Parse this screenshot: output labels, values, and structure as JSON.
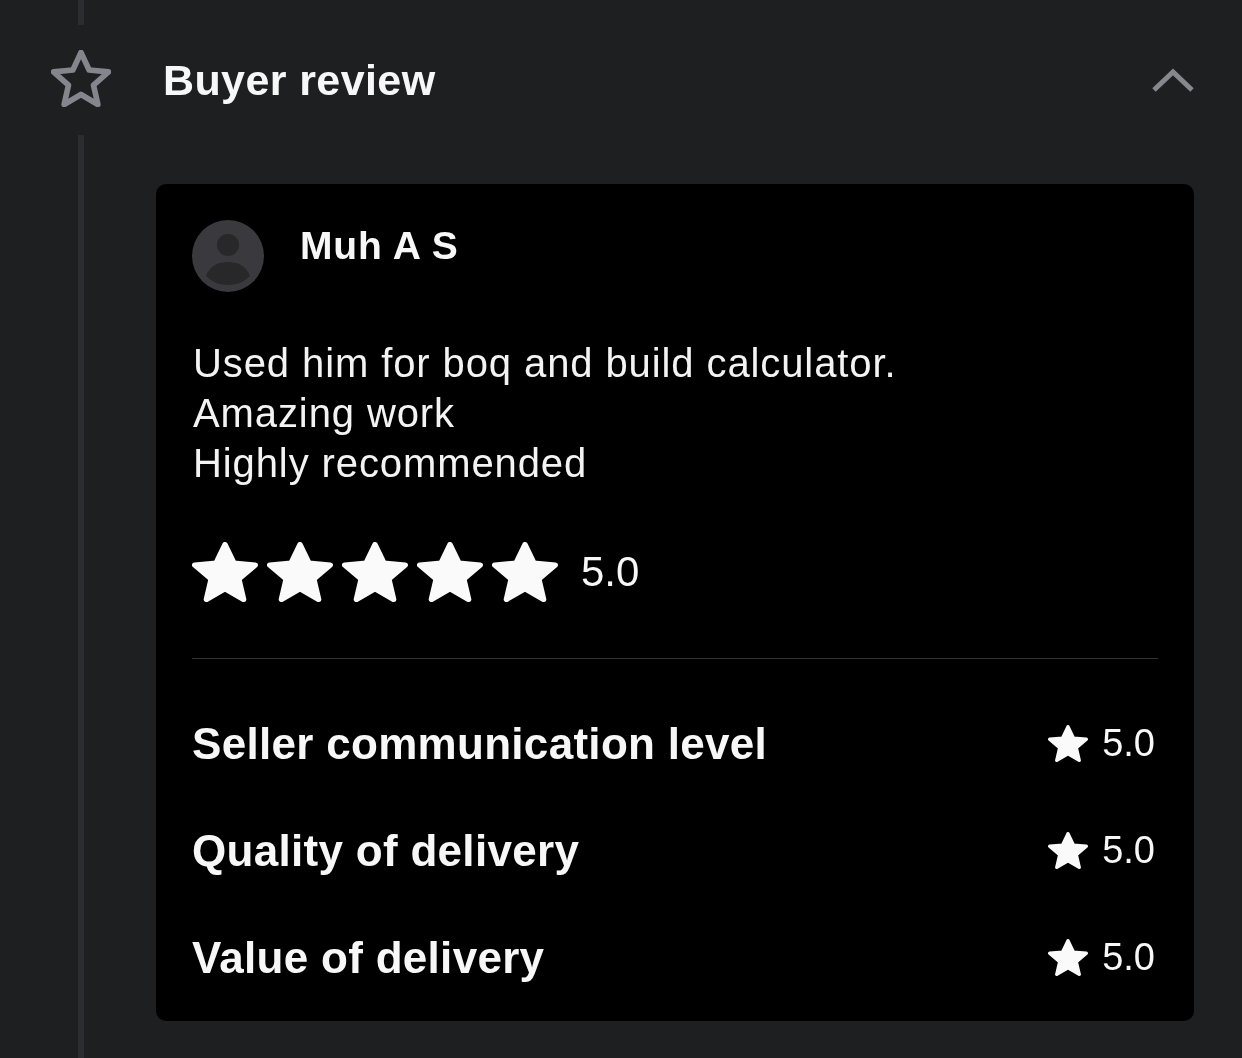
{
  "section": {
    "title": "Buyer review",
    "expanded": true
  },
  "review": {
    "reviewer": "Muh A S",
    "text": "Used him for boq and build calculator.\nAmazing work\nHighly recommended",
    "stars": 5,
    "rating": "5.0",
    "criteria": [
      {
        "label": "Seller communication level",
        "rating": "5.0"
      },
      {
        "label": "Quality of delivery",
        "rating": "5.0"
      },
      {
        "label": "Value of delivery",
        "rating": "5.0"
      }
    ]
  }
}
